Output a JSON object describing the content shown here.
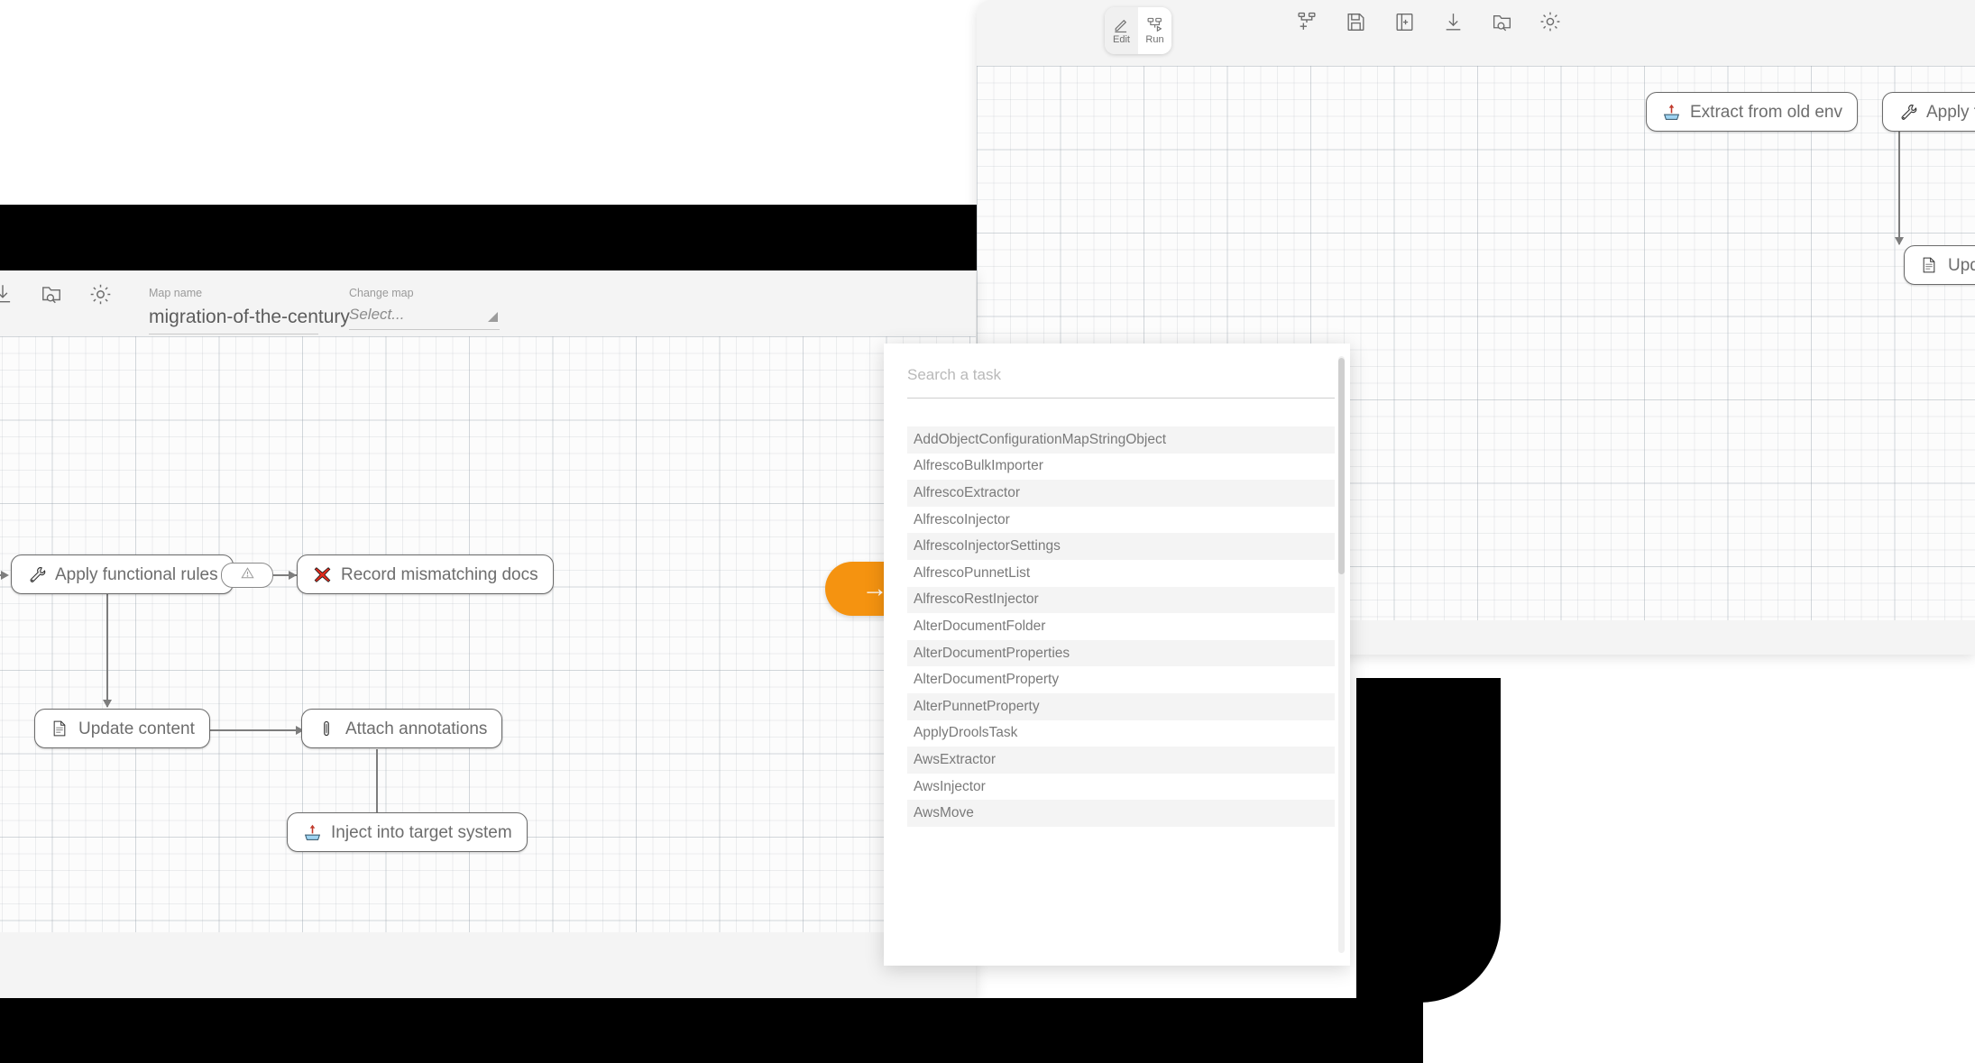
{
  "app": {
    "toolbar": {
      "mode_buttons": [
        {
          "label": "Edit",
          "icon": "pencil-icon",
          "active": true
        },
        {
          "label": "Run",
          "icon": "run-flow-icon",
          "active": false
        }
      ],
      "icons": [
        {
          "name": "add-node-icon",
          "title": "Add node"
        },
        {
          "name": "save-icon",
          "title": "Save"
        },
        {
          "name": "new-map-icon",
          "title": "New map"
        },
        {
          "name": "download-icon",
          "title": "Download"
        },
        {
          "name": "browse-folder-icon",
          "title": "Browse"
        },
        {
          "name": "settings-gear-icon",
          "title": "Settings"
        }
      ],
      "map_name_label": "Map name",
      "map_name_value": "migration-of-the-century",
      "change_map_label": "Change map",
      "change_map_placeholder": "Select..."
    },
    "colors": {
      "accent_orange": "#f59310",
      "node_border": "#6b6b6b",
      "node_text": "#6d6d6d",
      "canvas": "#fcfcfc",
      "chrome": "#f4f4f4"
    },
    "action_button": {
      "name": "next-step-button",
      "glyph": "→"
    }
  },
  "flow": {
    "nodes": [
      {
        "id": "extract",
        "label": "Extract from old env",
        "icon": "extractor-icon"
      },
      {
        "id": "rules",
        "label": "Apply functional rules",
        "icon": "wrench-icon"
      },
      {
        "id": "mismatch",
        "label": "Record mismatching docs",
        "icon": "red-cross-icon"
      },
      {
        "id": "update",
        "label": "Update content",
        "icon": "document-icon"
      },
      {
        "id": "annotate",
        "label": "Attach annotations",
        "icon": "annotation-icon"
      },
      {
        "id": "inject",
        "label": "Inject into target system",
        "icon": "injector-icon"
      }
    ],
    "gate": {
      "id": "error-gate",
      "icon": "warning-triangle-icon"
    },
    "edges": [
      {
        "from": "extract",
        "to": "rules"
      },
      {
        "from": "rules",
        "to": "error-gate"
      },
      {
        "from": "error-gate",
        "to": "mismatch"
      },
      {
        "from": "rules",
        "to": "update"
      },
      {
        "from": "update",
        "to": "annotate"
      },
      {
        "from": "annotate",
        "to": "inject"
      }
    ]
  },
  "task_panel": {
    "search_placeholder": "Search a task",
    "items": [
      "AddObjectConfigurationMapStringObject",
      "AlfrescoBulkImporter",
      "AlfrescoExtractor",
      "AlfrescoInjector",
      "AlfrescoInjectorSettings",
      "AlfrescoPunnetList",
      "AlfrescoRestInjector",
      "AlterDocumentFolder",
      "AlterDocumentProperties",
      "AlterDocumentProperty",
      "AlterPunnetProperty",
      "ApplyDroolsTask",
      "AwsExtractor",
      "AwsInjector",
      "AwsMove"
    ]
  }
}
